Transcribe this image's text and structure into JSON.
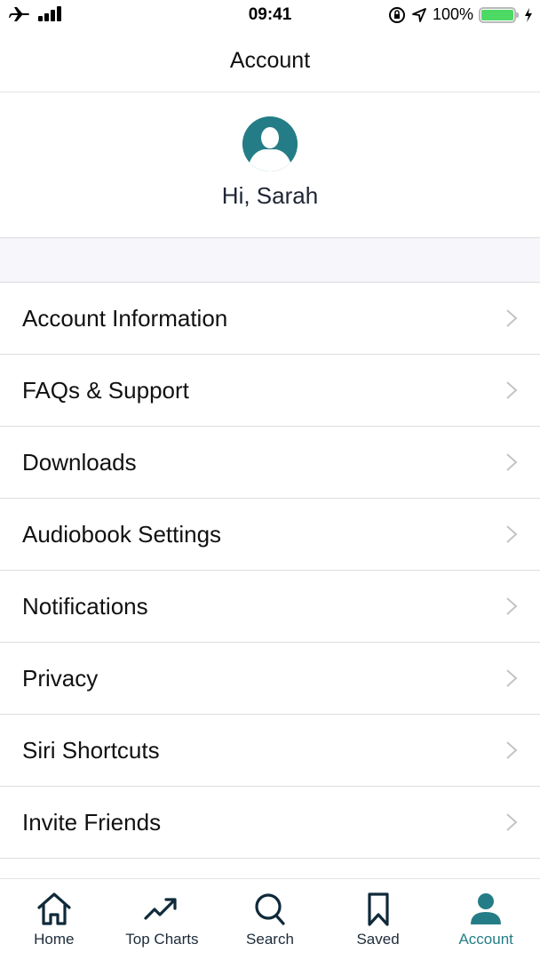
{
  "status_bar": {
    "time": "09:41",
    "battery_percent": "100%",
    "icons": [
      "airplane-icon",
      "signal-icon",
      "orientation-lock-icon",
      "location-icon",
      "battery-icon",
      "charging-icon"
    ]
  },
  "nav": {
    "title": "Account"
  },
  "profile": {
    "greeting": "Hi, Sarah",
    "avatar_icon": "user-avatar-icon"
  },
  "menu": {
    "items": [
      {
        "label": "Account Information"
      },
      {
        "label": "FAQs & Support"
      },
      {
        "label": "Downloads"
      },
      {
        "label": "Audiobook Settings"
      },
      {
        "label": "Notifications"
      },
      {
        "label": "Privacy"
      },
      {
        "label": "Siri Shortcuts"
      },
      {
        "label": "Invite Friends"
      }
    ]
  },
  "tab_bar": {
    "tabs": [
      {
        "label": "Home",
        "icon": "home-icon"
      },
      {
        "label": "Top Charts",
        "icon": "trending-icon"
      },
      {
        "label": "Search",
        "icon": "search-icon"
      },
      {
        "label": "Saved",
        "icon": "bookmark-icon"
      },
      {
        "label": "Account",
        "icon": "account-icon",
        "active": true
      }
    ]
  },
  "colors": {
    "accent": "#247d86",
    "tab_icon": "#0f2a3a",
    "battery": "#4cd964",
    "chevron": "#c4c4c4"
  }
}
